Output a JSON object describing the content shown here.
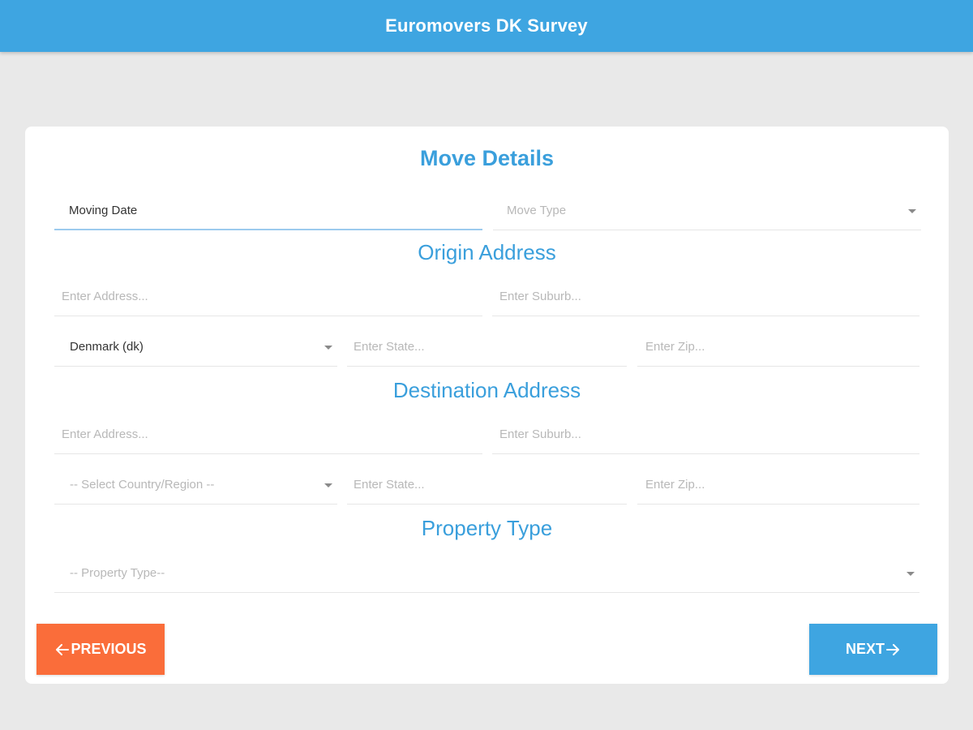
{
  "header": {
    "title": "Euromovers DK Survey"
  },
  "colors": {
    "accent": "#3ea5e1",
    "previous_button": "#fa6d3a",
    "background": "#e9e9e9"
  },
  "move_details": {
    "title": "Move Details",
    "moving_date": {
      "value": "Moving Date"
    },
    "move_type": {
      "placeholder": "Move Type"
    }
  },
  "origin": {
    "title": "Origin Address",
    "address_placeholder": "Enter Address...",
    "suburb_placeholder": "Enter Suburb...",
    "country_value": "Denmark (dk)",
    "state_placeholder": "Enter State...",
    "zip_placeholder": "Enter Zip..."
  },
  "destination": {
    "title": "Destination Address",
    "address_placeholder": "Enter Address...",
    "suburb_placeholder": "Enter Suburb...",
    "country_placeholder": "-- Select Country/Region --",
    "state_placeholder": "Enter State...",
    "zip_placeholder": "Enter Zip..."
  },
  "property": {
    "title": "Property Type",
    "placeholder": "-- Property Type--"
  },
  "buttons": {
    "previous_label": "PREVIOUS",
    "previous_icon": "arrow-left-icon",
    "next_label": "NEXT",
    "next_icon": "arrow-right-icon"
  }
}
